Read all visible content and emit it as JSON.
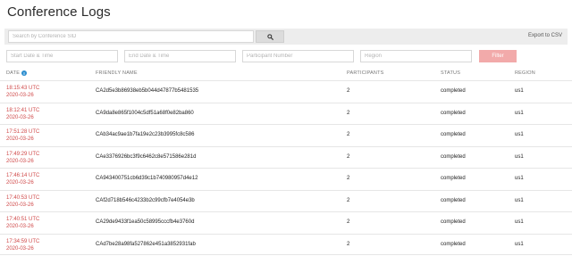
{
  "title": "Conference Logs",
  "search": {
    "placeholder": "Search by Conference SID"
  },
  "export_label": "Export to CSV",
  "filters": {
    "start_placeholder": "Start Date & Time",
    "end_placeholder": "End Date & Time",
    "participant_placeholder": "Participant Number",
    "region_placeholder": "Region",
    "filter_label": "Filter"
  },
  "columns": {
    "date": "DATE",
    "friendly_name": "FRIENDLY NAME",
    "participants": "PARTICIPANTS",
    "status": "STATUS",
    "region": "REGION"
  },
  "rows": [
    {
      "time": "18:15:43 UTC",
      "date": "2020-03-26",
      "name": "CA2d5e3b86938eb5b044d47877b5481535",
      "participants": "2",
      "status": "completed",
      "region": "us1"
    },
    {
      "time": "18:12:41 UTC",
      "date": "2020-03-26",
      "name": "CA9da8e865f1004c5df51a68f0e82ba860",
      "participants": "2",
      "status": "completed",
      "region": "us1"
    },
    {
      "time": "17:51:28 UTC",
      "date": "2020-03-26",
      "name": "CAb34ac9ae1b7fa19e2c23b3995fc8c586",
      "participants": "2",
      "status": "completed",
      "region": "us1"
    },
    {
      "time": "17:49:29 UTC",
      "date": "2020-03-26",
      "name": "CAe3376926bc3f9c6462c8e571586e281d",
      "participants": "2",
      "status": "completed",
      "region": "us1"
    },
    {
      "time": "17:46:14 UTC",
      "date": "2020-03-26",
      "name": "CA943400751cb6d39c1b740980957d4e12",
      "participants": "2",
      "status": "completed",
      "region": "us1"
    },
    {
      "time": "17:40:53 UTC",
      "date": "2020-03-26",
      "name": "CAf2d718b546c4233b2c99cfb7e4054e3b",
      "participants": "2",
      "status": "completed",
      "region": "us1"
    },
    {
      "time": "17:40:51 UTC",
      "date": "2020-03-26",
      "name": "CA29de9433f1ea50c58995cccfb4e3760d",
      "participants": "2",
      "status": "completed",
      "region": "us1"
    },
    {
      "time": "17:34:59 UTC",
      "date": "2020-03-26",
      "name": "CAd7be28a98fa527862e451a3852931fab",
      "participants": "2",
      "status": "completed",
      "region": "us1"
    }
  ]
}
